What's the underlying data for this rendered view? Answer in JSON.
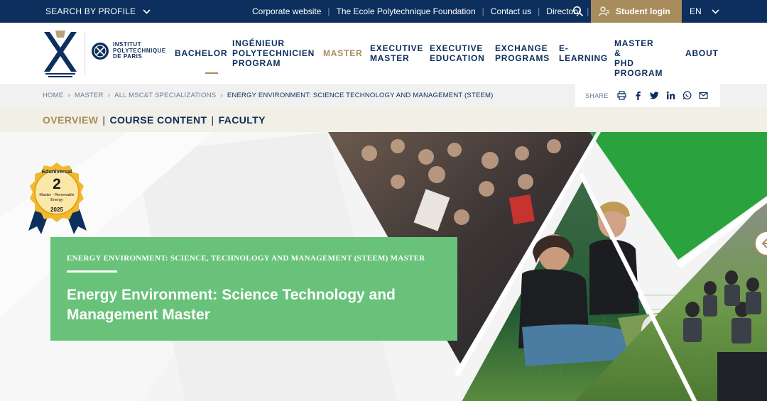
{
  "topbar": {
    "profile_label": "SEARCH BY PROFILE",
    "links": [
      "Corporate website",
      "The Ecole Polytechnique Foundation",
      "Contact us",
      "Directory"
    ],
    "login_label": "Student login",
    "lang_label": "EN"
  },
  "header": {
    "institut_lines": [
      "INSTITUT",
      "POLYTECHNIQUE",
      "DE PARIS"
    ],
    "nav": [
      {
        "label": "BACHELOR",
        "active": false
      },
      {
        "label": "INGÉNIEUR\nPOLYTECHNICIEN\nPROGRAM",
        "active": false
      },
      {
        "label": "MASTER",
        "active": true
      },
      {
        "label": "EXECUTIVE\nMASTER",
        "active": false
      },
      {
        "label": "EXECUTIVE\nEDUCATION",
        "active": false
      },
      {
        "label": "EXCHANGE\nPROGRAMS",
        "active": false
      },
      {
        "label": "E-\nLEARNING",
        "active": false
      },
      {
        "label": "MASTER &\nPHD\nPROGRAM",
        "active": false
      },
      {
        "label": "ABOUT",
        "active": false
      }
    ]
  },
  "breadcrumb": {
    "items": [
      "HOME",
      "MASTER",
      "ALL MSC&T SPECIALIZATIONS"
    ],
    "current": "ENERGY ENVIRONMENT: SCIENCE TECHNOLOGY AND MANAGEMENT (STEEM)",
    "share_label": "SHARE",
    "share_icons": [
      "print-icon",
      "facebook-icon",
      "twitter-icon",
      "linkedin-icon",
      "whatsapp-icon",
      "email-icon"
    ]
  },
  "subtabs": [
    {
      "label": "OVERVIEW",
      "active": true
    },
    {
      "label": "COURSE CONTENT",
      "active": false
    },
    {
      "label": "FACULTY",
      "active": false
    }
  ],
  "hero": {
    "badge": {
      "brand": "Eduniversal",
      "rank": "2",
      "subtitle": "Master - Renewable Energy",
      "year": "2025"
    },
    "overline": "ENERGY ENVIRONMENT: SCIENCE, TECHNOLOGY AND MANAGEMENT (STEEM) MASTER",
    "title": "Energy Environment: Science Technology and\nManagement Master"
  },
  "colors": {
    "navy": "#0d2f5e",
    "gold": "#a98c5b",
    "green": "#68c27a",
    "beige": "#f2efe7"
  }
}
